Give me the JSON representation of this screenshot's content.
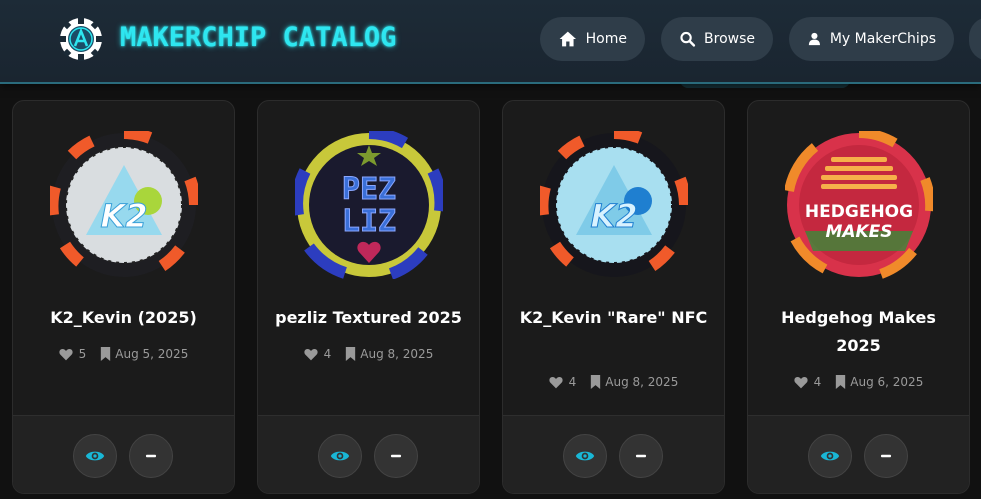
{
  "header": {
    "app_title": "MAKERCHIP CATALOG",
    "nav": [
      {
        "label": "Home",
        "icon": "home-icon"
      },
      {
        "label": "Browse",
        "icon": "search-icon"
      },
      {
        "label": "My MakerChips",
        "icon": "user-icon"
      }
    ]
  },
  "colors": {
    "accent": "#2ee6f0",
    "view_icon": "#19b7d6",
    "card_bg": "#1b1b1b",
    "header_bg": "#1d2b37"
  },
  "cards": [
    {
      "title": "K2_Kevin (2025)",
      "likes": "5",
      "date": "Aug 5, 2025",
      "chip_text": "K2"
    },
    {
      "title": "pezliz Textured 2025",
      "likes": "4",
      "date": "Aug 8, 2025",
      "chip_text": "PEZ LIZ"
    },
    {
      "title": "K2_Kevin \"Rare\" NFC",
      "likes": "4",
      "date": "Aug 8, 2025",
      "chip_text": "K2"
    },
    {
      "title": "Hedgehog Makes 2025",
      "likes": "4",
      "date": "Aug 6, 2025",
      "chip_text": "HEDGEHOG MAKES"
    }
  ]
}
